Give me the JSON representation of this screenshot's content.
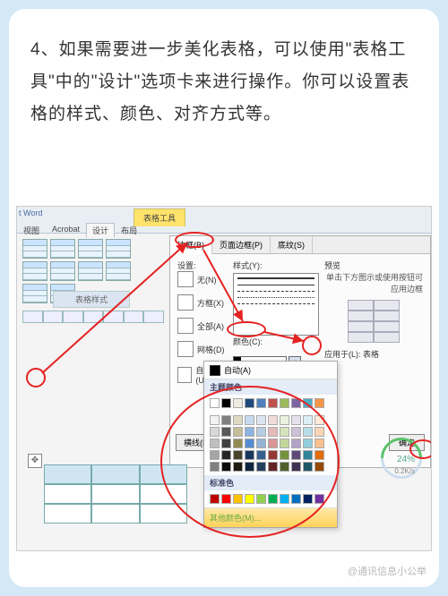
{
  "instruction": "4、如果需要进一步美化表格，可以使用\"表格工具\"中的\"设计\"选项卡来进行操作。你可以设置表格的样式、颜色、对齐方式等。",
  "ribbon": {
    "app_title": "t Word",
    "group_label": "表格工具",
    "tabs": [
      "视图",
      "Acrobat",
      "设计",
      "布局"
    ],
    "gallery_label": "表格样式"
  },
  "dialog": {
    "tabs": {
      "borders": "边框(B)",
      "page_border": "页面边框(P)",
      "shading": "底纹(S)"
    },
    "settings_label": "设置:",
    "opts": {
      "none": "无(N)",
      "box": "方框(X)",
      "all": "全部(A)",
      "grid": "网格(D)",
      "custom": "自定义(U)"
    },
    "style_label": "样式(Y):",
    "color_label": "颜色(C):",
    "preview_label": "预览",
    "preview_hint": "单击下方图示或使用按钮可应用边框",
    "apply_to_label": "应用于(L):",
    "apply_to_value": "表格",
    "hline_btn": "横线(H)...",
    "ok_btn": "确定"
  },
  "color_popup": {
    "auto": "自动(A)",
    "theme_hdr": "主题颜色",
    "std_hdr": "标准色",
    "more": "其他颜色(M)...",
    "theme_colors": [
      "#ffffff",
      "#000000",
      "#eeece1",
      "#1f497d",
      "#4f81bd",
      "#c0504d",
      "#9bbb59",
      "#8064a2",
      "#4bacc6",
      "#f79646"
    ],
    "theme_tints": [
      [
        "#f2f2f2",
        "#7f7f7f",
        "#ddd9c3",
        "#c6d9f0",
        "#dbe5f1",
        "#f2dcdb",
        "#ebf1dd",
        "#e5e0ec",
        "#dbeef3",
        "#fdeada"
      ],
      [
        "#d8d8d8",
        "#595959",
        "#c4bd97",
        "#8db3e2",
        "#b8cce4",
        "#e5b9b7",
        "#d7e3bc",
        "#ccc1d9",
        "#b7dde8",
        "#fbd5b5"
      ],
      [
        "#bfbfbf",
        "#3f3f3f",
        "#938953",
        "#548dd4",
        "#95b3d7",
        "#d99694",
        "#c3d69b",
        "#b2a2c7",
        "#92cddc",
        "#fac08f"
      ],
      [
        "#a5a5a5",
        "#262626",
        "#494429",
        "#17365d",
        "#366092",
        "#953734",
        "#76923c",
        "#5f497a",
        "#31859b",
        "#e36c09"
      ],
      [
        "#7f7f7f",
        "#0c0c0c",
        "#1d1b10",
        "#0f243e",
        "#244061",
        "#632423",
        "#4f6128",
        "#3f3151",
        "#205867",
        "#974806"
      ]
    ],
    "standard_colors": [
      "#c00000",
      "#ff0000",
      "#ffc000",
      "#ffff00",
      "#92d050",
      "#00b050",
      "#00b0f0",
      "#0070c0",
      "#002060",
      "#7030a0"
    ]
  },
  "gauge": {
    "percent": "24%",
    "rate": "0.2K/s"
  },
  "watermark": "@通讯信息小公举"
}
